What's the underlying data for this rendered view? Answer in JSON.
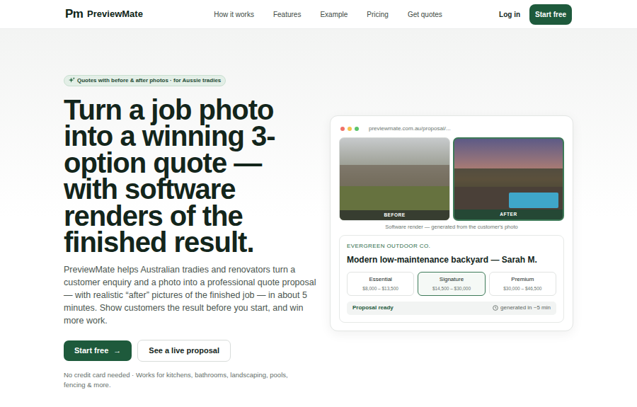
{
  "nav": {
    "logo_mark": "Pm",
    "brand": "PreviewMate",
    "links": [
      {
        "label": "How it works"
      },
      {
        "label": "Features"
      },
      {
        "label": "Example"
      },
      {
        "label": "Pricing"
      },
      {
        "label": "Get quotes"
      }
    ],
    "login": "Log in",
    "cta": "Start free"
  },
  "hero": {
    "badge": "Quotes with before & after photos · for Aussie tradies",
    "headline": "Turn a job photo into a winning 3-option quote — with software renders of the finished result.",
    "paragraph": "PreviewMate helps Australian tradies and renovators turn a customer enquiry and a photo into a professional quote proposal — with realistic “after” pictures of the finished job — in about 5 minutes. Show customers the result before you start, and win more work.",
    "primary_button": "Start free",
    "primary_arrow": "→",
    "secondary_button": "See a live proposal",
    "note": "No credit card needed · Works for kitchens, bathrooms, landscaping, pools, fencing & more."
  },
  "preview": {
    "url": "previewmate.com.au/proposal/...",
    "before_label": "BEFORE",
    "after_label": "AFTER",
    "caption": "Software render — generated from the customer's photo",
    "company": "EVERGREEN OUTDOOR CO.",
    "title": "Modern low-maintenance backyard — Sarah M.",
    "options": [
      {
        "name": "Essential",
        "price": "$8,000 – $13,500",
        "selected": false
      },
      {
        "name": "Signature",
        "price": "$14,500 – $30,000",
        "selected": true
      },
      {
        "name": "Premium",
        "price": "$30,000 – $46,500",
        "selected": false
      }
    ],
    "status": "Proposal ready",
    "time": "generated in ~5 min"
  }
}
